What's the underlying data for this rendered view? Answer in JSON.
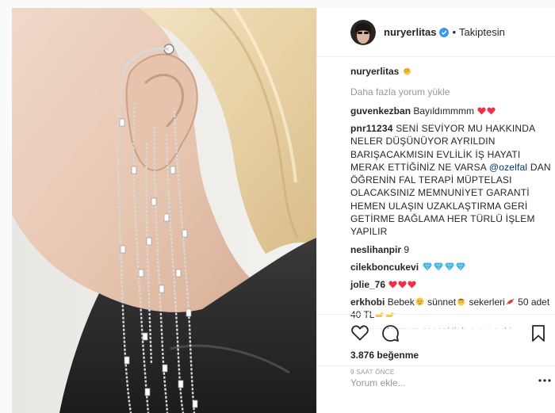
{
  "post": {
    "username": "nuryerlitas",
    "follow_dot": "•",
    "follow_label": "Takiptesin",
    "load_more": "Daha fazla yorum yükle",
    "comments": [
      {
        "user": "guvenkezban",
        "text": "Bayıldımmmm"
      },
      {
        "user": "pnr11234",
        "text_before": "SENİ SEVİYOR MU HAKKINDA NELER DÜŞÜNÜYOR AYRILDIN BARIŞACAKMISIN EVLİLİK İŞ HAYATI MERAK ETTİĞİNİZ NE VARSA",
        "mention": "@ozelfal",
        "text_after": "DAN ÖĞRENİN FAL TERAPİ MÜPTELASI OLACAKSINIZ MEMNUNİYET GARANTİ HEMEN ULAŞIN UZAKLAŞTIRMA GERİ GETİRME BAĞLAMA HER TÜRLÜ İŞLEM YAPILIR"
      },
      {
        "user": "neslihanpir",
        "text": "9"
      },
      {
        "user": "cilekboncukevi",
        "text": ""
      },
      {
        "user": "jolie_76",
        "text": ""
      },
      {
        "user": "erkhobi",
        "text_1": "Bebek",
        "text_2": "sünnet",
        "text_3": "sekerleri",
        "text_4": "50 adet 40 TL"
      }
    ],
    "truncated_comment": "n dosus Nursum ssosekik h e o u e d i",
    "likes": "3.876 beğenme",
    "time": "9 SAAT ÖNCE",
    "comment_placeholder": "Yorum ekle..."
  },
  "icons": {
    "verified": "verified-badge-icon",
    "caption_emoji": "ok-hand-emoji-icon",
    "like": "heart-outline-icon",
    "comment": "speech-bubble-icon",
    "save": "bookmark-icon",
    "more": "ellipsis-icon"
  },
  "colors": {
    "verified": "#3897f0",
    "username": "#262626",
    "secondary": "#999999",
    "mention": "#003569",
    "heart_emoji": "#e8334a",
    "gem_emoji": "#3ab0e2"
  }
}
